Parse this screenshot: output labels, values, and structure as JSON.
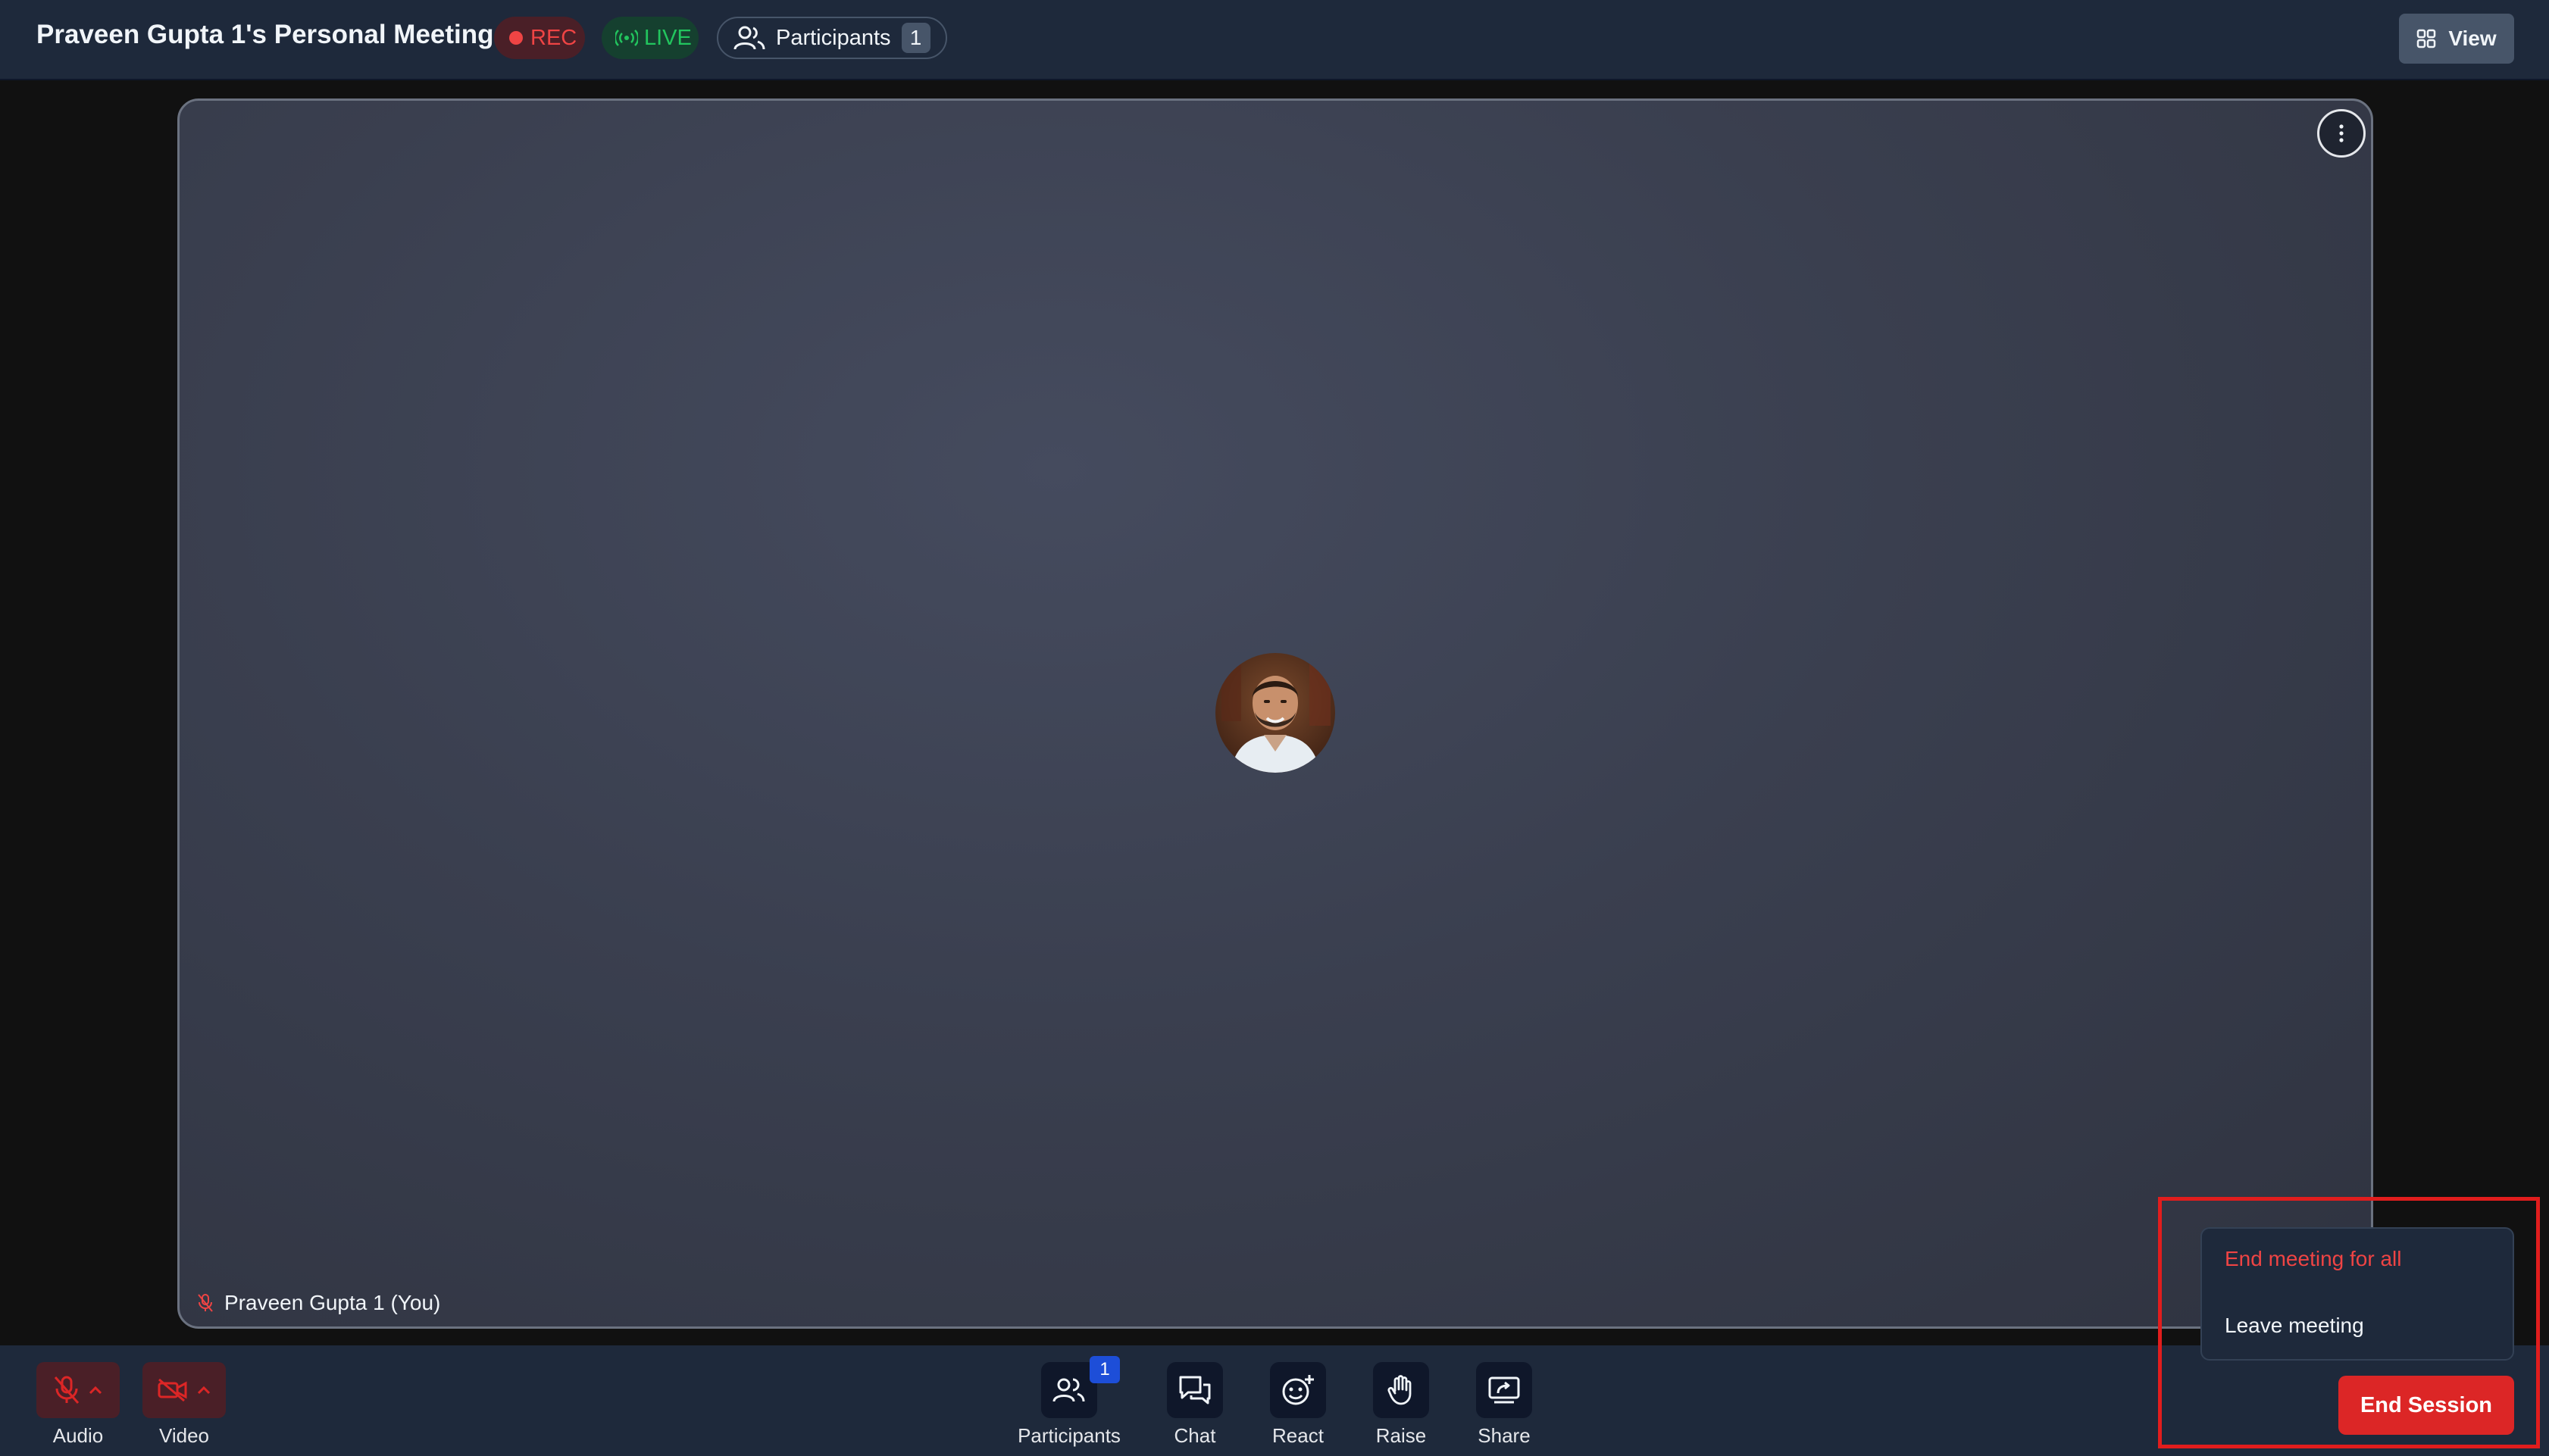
{
  "header": {
    "title": "Praveen Gupta 1's Personal Meeting",
    "rec_label": "REC",
    "live_label": "LIVE",
    "participants_label": "Participants",
    "participants_count": "1",
    "view_label": "View"
  },
  "tile": {
    "participant_name": "Praveen Gupta 1 (You)",
    "mic_state": "muted"
  },
  "toolbar": {
    "audio_label": "Audio",
    "video_label": "Video",
    "participants_label": "Participants",
    "participants_badge": "1",
    "chat_label": "Chat",
    "react_label": "React",
    "raise_label": "Raise",
    "share_label": "Share"
  },
  "end_menu": {
    "end_for_all_label": "End meeting for all",
    "leave_label": "Leave meeting",
    "end_session_label": "End Session"
  },
  "colors": {
    "header_bg": "#1e293b",
    "danger": "#ef4444",
    "live": "#22c55e",
    "badge_blue": "#1d4ed8"
  }
}
